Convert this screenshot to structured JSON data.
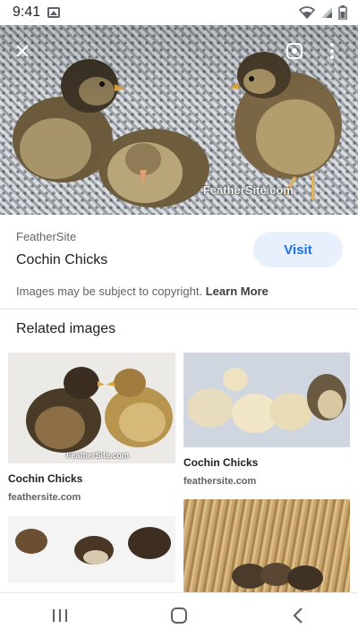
{
  "status_bar": {
    "time": "9:41"
  },
  "hero": {
    "watermark": "FeatherSite.com"
  },
  "info": {
    "source": "FeatherSite",
    "title": "Cochin Chicks",
    "visit_label": "Visit",
    "copyright_text": "Images may be subject to copyright.",
    "learn_more": "Learn More"
  },
  "related": {
    "heading": "Related images",
    "items": [
      {
        "title": "Cochin Chicks",
        "source": "feathersite.com",
        "watermark": "FeatherSite.com"
      },
      {
        "title": "Cochin Chicks",
        "source": "feathersite.com",
        "watermark": ""
      },
      {
        "title": "",
        "source": ""
      },
      {
        "title": "",
        "source": ""
      }
    ]
  },
  "colors": {
    "accent": "#1a73e8",
    "visit_bg": "#e8f0fe",
    "text_primary": "#202124",
    "text_secondary": "#5f6368"
  },
  "icons": [
    "close-icon",
    "lens-icon",
    "more-vert-icon",
    "recents-icon",
    "home-icon",
    "back-icon",
    "wifi-icon",
    "signal-icon",
    "battery-icon",
    "image-icon"
  ]
}
